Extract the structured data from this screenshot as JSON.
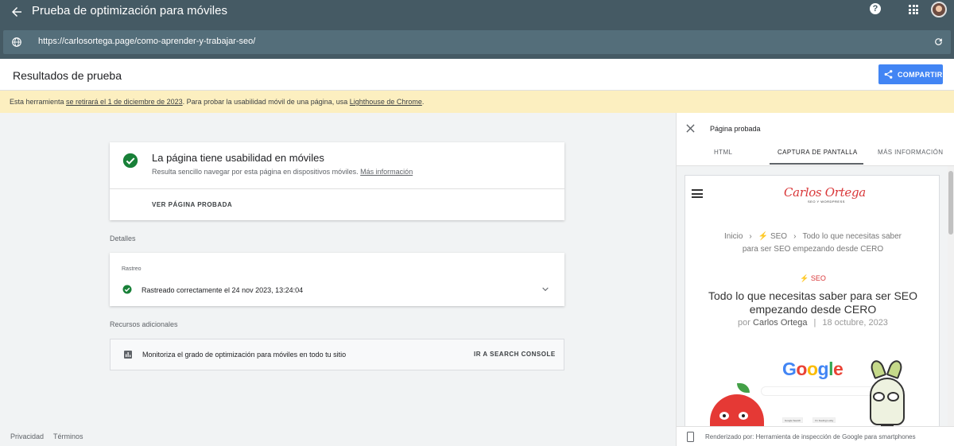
{
  "header": {
    "title": "Prueba de optimización para móviles",
    "url": "https://carlosortega.page/como-aprender-y-trabajar-seo/",
    "help_icon": "help-icon",
    "apps_icon": "apps-grid-icon"
  },
  "results": {
    "title": "Resultados de prueba",
    "share_label": "COMPARTIR"
  },
  "banner": {
    "text_1": "Esta herramienta ",
    "link_1": "se retirará el 1 de diciembre de 2023",
    "text_2": ". Para probar la usabilidad móvil de una página, usa ",
    "link_2": "Lighthouse de Chrome",
    "text_3": "."
  },
  "summary": {
    "title": "La página tiene usabilidad en móviles",
    "subtitle": "Resulta sencillo navegar por esta página en dispositivos móviles.",
    "more_link": "Más información",
    "button": "VER PÁGINA PROBADA"
  },
  "details": {
    "heading": "Detalles",
    "crawl_label": "Rastreo",
    "crawl_status": "Rastreado correctamente el 24 nov 2023, 13:24:04"
  },
  "resources": {
    "heading": "Recursos adicionales",
    "text": "Monitoriza el grado de optimización para móviles en todo tu sitio",
    "button": "IR A SEARCH CONSOLE"
  },
  "footer": {
    "privacy": "Privacidad",
    "terms": "Términos"
  },
  "panel": {
    "title": "Página probada",
    "tabs": [
      {
        "label": "HTML",
        "active": false
      },
      {
        "label": "CAPTURA DE PANTALLA",
        "active": true
      },
      {
        "label": "MÁS INFORMACIÓN",
        "active": false
      }
    ],
    "footer_text": "Renderizado por: Herramienta de inspección de Google para smartphones"
  },
  "screenshot": {
    "logo": "Carlos Ortega",
    "logo_sub": "SEO Y WORDPRESS",
    "crumb_home": "Inicio",
    "crumb_sep": "›",
    "crumb_cat": "⚡ SEO",
    "crumb_page_1": "Todo lo que necesitas saber",
    "crumb_page_2": "para ser SEO empezando desde CERO",
    "category": "⚡ SEO",
    "post_title": "Todo lo que necesitas saber para ser SEO empezando desde CERO",
    "meta_by": "por ",
    "meta_author": "Carlos Ortega",
    "meta_sep": "|",
    "meta_date": "18 octubre, 2023",
    "google_letters": [
      {
        "ch": "G",
        "color": "#4285f4"
      },
      {
        "ch": "o",
        "color": "#ea4335"
      },
      {
        "ch": "o",
        "color": "#fbbc05"
      },
      {
        "ch": "g",
        "color": "#4285f4"
      },
      {
        "ch": "l",
        "color": "#34a853"
      },
      {
        "ch": "e",
        "color": "#ea4335"
      }
    ],
    "search_btn_1": "Google Search",
    "search_btn_2": "I'm Feeling Lucky"
  },
  "colors": {
    "appbar": "#455a64",
    "urlbar": "#546e7a",
    "accent": "#4285f4",
    "success": "#188038",
    "banner": "#fcefc0"
  }
}
